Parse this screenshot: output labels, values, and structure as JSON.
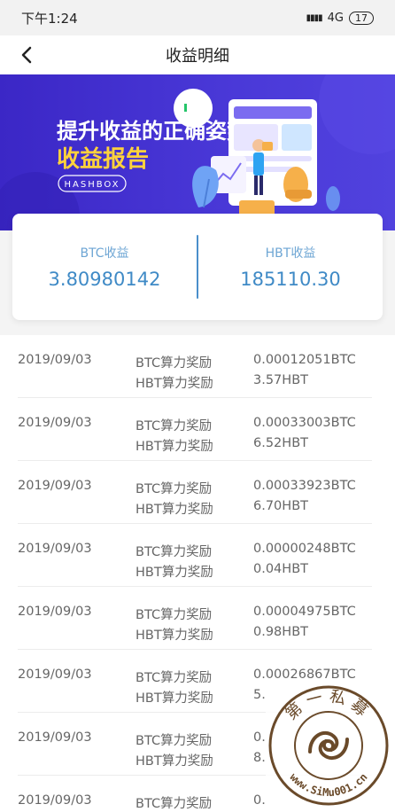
{
  "status": {
    "time": "下午1:24",
    "network": "4G",
    "battery": "17"
  },
  "nav": {
    "title": "收益明细"
  },
  "banner": {
    "line1": "提升收益的正确姿势",
    "line2": "收益报告",
    "tag": "HASHBOX"
  },
  "summary": {
    "left": {
      "label": "BTC收益",
      "value": "3.80980142"
    },
    "right": {
      "label": "HBT收益",
      "value": "185110.30"
    }
  },
  "records": [
    {
      "date": "2019/09/03",
      "type1": "BTC算力奖励",
      "type2": "HBT算力奖励",
      "amt1": "0.00012051BTC",
      "amt2": "3.57HBT"
    },
    {
      "date": "2019/09/03",
      "type1": "BTC算力奖励",
      "type2": "HBT算力奖励",
      "amt1": "0.00033003BTC",
      "amt2": "6.52HBT"
    },
    {
      "date": "2019/09/03",
      "type1": "BTC算力奖励",
      "type2": "HBT算力奖励",
      "amt1": "0.00033923BTC",
      "amt2": "6.70HBT"
    },
    {
      "date": "2019/09/03",
      "type1": "BTC算力奖励",
      "type2": "HBT算力奖励",
      "amt1": "0.00000248BTC",
      "amt2": "0.04HBT"
    },
    {
      "date": "2019/09/03",
      "type1": "BTC算力奖励",
      "type2": "HBT算力奖励",
      "amt1": "0.00004975BTC",
      "amt2": "0.98HBT"
    },
    {
      "date": "2019/09/03",
      "type1": "BTC算力奖励",
      "type2": "HBT算力奖励",
      "amt1": "0.00026867BTC",
      "amt2": "5."
    },
    {
      "date": "2019/09/03",
      "type1": "BTC算力奖励",
      "type2": "HBT算力奖励",
      "amt1": "0.",
      "amt2": "8."
    },
    {
      "date": "2019/09/03",
      "type1": "BTC算力奖励",
      "type2": "",
      "amt1": "0.",
      "amt2": ""
    }
  ],
  "watermark": {
    "top": "第一私募",
    "bottom": "www.SiMu001.cn"
  },
  "icons": {
    "back": "chevron-left-icon",
    "signal": "signal-icon",
    "battery": "battery-icon"
  },
  "colors": {
    "accent": "#3f8ac6",
    "banner": "#4a39d8",
    "label": "#6ea6d4"
  }
}
